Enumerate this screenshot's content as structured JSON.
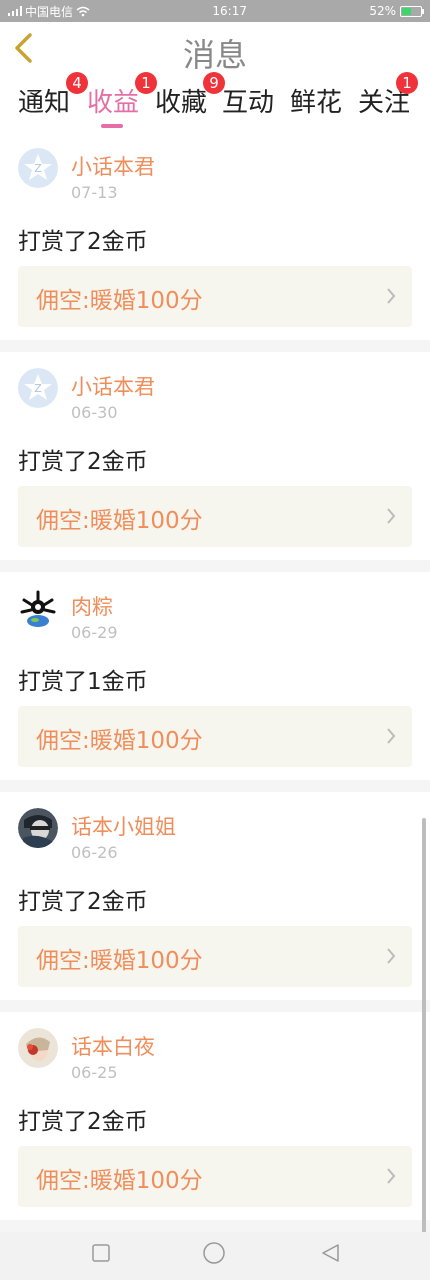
{
  "status_bar": {
    "carrier": "中国电信",
    "time": "16:17",
    "battery": "52%",
    "battery_level": 0.52
  },
  "header": {
    "title": "消息"
  },
  "tabs": [
    {
      "label": "通知",
      "badge": "4"
    },
    {
      "label": "收益",
      "badge": "1",
      "active": true
    },
    {
      "label": "收藏",
      "badge": "9"
    },
    {
      "label": "互动",
      "badge": ""
    },
    {
      "label": "鲜花",
      "badge": ""
    },
    {
      "label": "关注",
      "badge": "1"
    }
  ],
  "items": [
    {
      "user": "小话本君",
      "date": "07-13",
      "text": "打赏了2金币",
      "book": "佣空:暖婚100分",
      "avatar": "official-logo"
    },
    {
      "user": "小话本君",
      "date": "06-30",
      "text": "打赏了2金币",
      "book": "佣空:暖婚100分",
      "avatar": "official-logo"
    },
    {
      "user": "肉粽",
      "date": "06-29",
      "text": "打赏了1金币",
      "book": "佣空:暖婚100分",
      "avatar": "character-art"
    },
    {
      "user": "话本小姐姐",
      "date": "06-26",
      "text": "打赏了2金币",
      "book": "佣空:暖婚100分",
      "avatar": "photo"
    },
    {
      "user": "话本白夜",
      "date": "06-25",
      "text": "打赏了2金币",
      "book": "佣空:暖婚100分",
      "avatar": "photo"
    }
  ],
  "colors": {
    "accent": "#e46fa7",
    "username": "#f08e5b",
    "badge": "#f0333a",
    "back_arrow": "#c8a531"
  },
  "icons": {
    "back": "chevron-left-icon",
    "chevron": "chevron-right-icon"
  }
}
